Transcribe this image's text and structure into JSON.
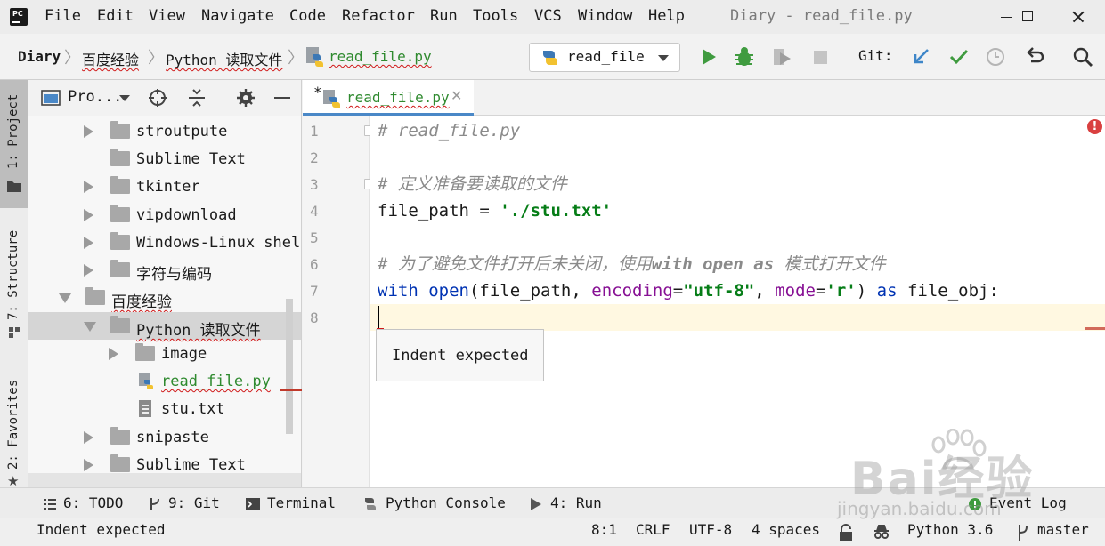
{
  "window": {
    "title": "Diary - read_file.py",
    "menu": [
      "File",
      "Edit",
      "View",
      "Navigate",
      "Code",
      "Refactor",
      "Run",
      "Tools",
      "VCS",
      "Window",
      "Help"
    ],
    "app_logo_text": "PC"
  },
  "navbar": {
    "breadcrumbs": [
      "Diary",
      "百度经验",
      "Python 读取文件",
      "read_file.py"
    ],
    "run_config": "read_file",
    "git_label": "Git:"
  },
  "left_stripe": {
    "tabs": [
      "1: Project",
      "7: Structure",
      "2: Favorites"
    ]
  },
  "project": {
    "title": "Pro...",
    "tree": [
      {
        "label": "stroutpute",
        "type": "folder",
        "expanded": false
      },
      {
        "label": "Sublime Text",
        "type": "folder",
        "leaf": true
      },
      {
        "label": "tkinter",
        "type": "folder",
        "expanded": false
      },
      {
        "label": "vipdownload",
        "type": "folder",
        "expanded": false
      },
      {
        "label": "Windows-Linux shell",
        "type": "folder",
        "expanded": false
      },
      {
        "label": "字符与编码",
        "type": "folder",
        "expanded": false
      },
      {
        "label": "百度经验",
        "type": "folder",
        "expanded": true
      },
      {
        "label": "Python 读取文件",
        "type": "folder",
        "expanded": true,
        "selected": true
      },
      {
        "label": "image",
        "type": "folder",
        "expanded": false
      },
      {
        "label": "read_file.py",
        "type": "python"
      },
      {
        "label": "stu.txt",
        "type": "text"
      },
      {
        "label": "snipaste",
        "type": "folder",
        "expanded": false
      },
      {
        "label": "Sublime Text",
        "type": "folder",
        "expanded": false
      }
    ]
  },
  "editor": {
    "tab": {
      "label": "read_file.py",
      "modified_marker": "*"
    },
    "line_numbers": [
      "1",
      "2",
      "3",
      "4",
      "5",
      "6",
      "7",
      "8"
    ],
    "lines": {
      "l1": "# read_file.py",
      "l3": "# 定义准备要读取的文件",
      "l4_var": "file_path",
      "l4_op": " = ",
      "l4_str": "'./stu.txt'",
      "l6_a": "# 为了避免文件打开后未关闭，使用",
      "l6_b": "with open as",
      "l6_c": " 模式打开文件",
      "l7_with": "with",
      "l7_open": " open",
      "l7_a": "(file_path, ",
      "l7_enc": "encoding",
      "l7_eq": "=",
      "l7_encval": "\"utf-8\"",
      "l7_comma": ", ",
      "l7_mode": "mode",
      "l7_eq2": "=",
      "l7_modeval": "'r'",
      "l7_close": ") ",
      "l7_as": "as",
      "l7_obj": " file_obj:"
    },
    "tooltip": "Indent expected",
    "error_glyph": "!"
  },
  "tool_windows": [
    {
      "label": "6: TODO",
      "icon": "todo-icon"
    },
    {
      "label": "9: Git",
      "icon": "git-branch-icon"
    },
    {
      "label": "Terminal",
      "icon": "terminal-icon"
    },
    {
      "label": "Python Console",
      "icon": "python-console-icon"
    },
    {
      "label": "4: Run",
      "icon": "run-icon"
    },
    {
      "label": "Event Log",
      "icon": "event-log-icon"
    }
  ],
  "status": {
    "message": "Indent expected",
    "position": "8:1",
    "line_sep": "CRLF",
    "encoding": "UTF-8",
    "indent": "4 spaces",
    "interpreter": "Python 3.6",
    "branch": "master"
  },
  "watermark": {
    "brand": "Bai经验",
    "url": "jingyan.baidu.com"
  },
  "colors": {
    "keyword": "#0033b3",
    "string": "#067d17",
    "parameter": "#871094",
    "comment": "#8a8a8a",
    "current_line": "#fff8e1",
    "error": "#d94040",
    "run_green": "#3f9b3f",
    "git_blue": "#3e86c8"
  }
}
